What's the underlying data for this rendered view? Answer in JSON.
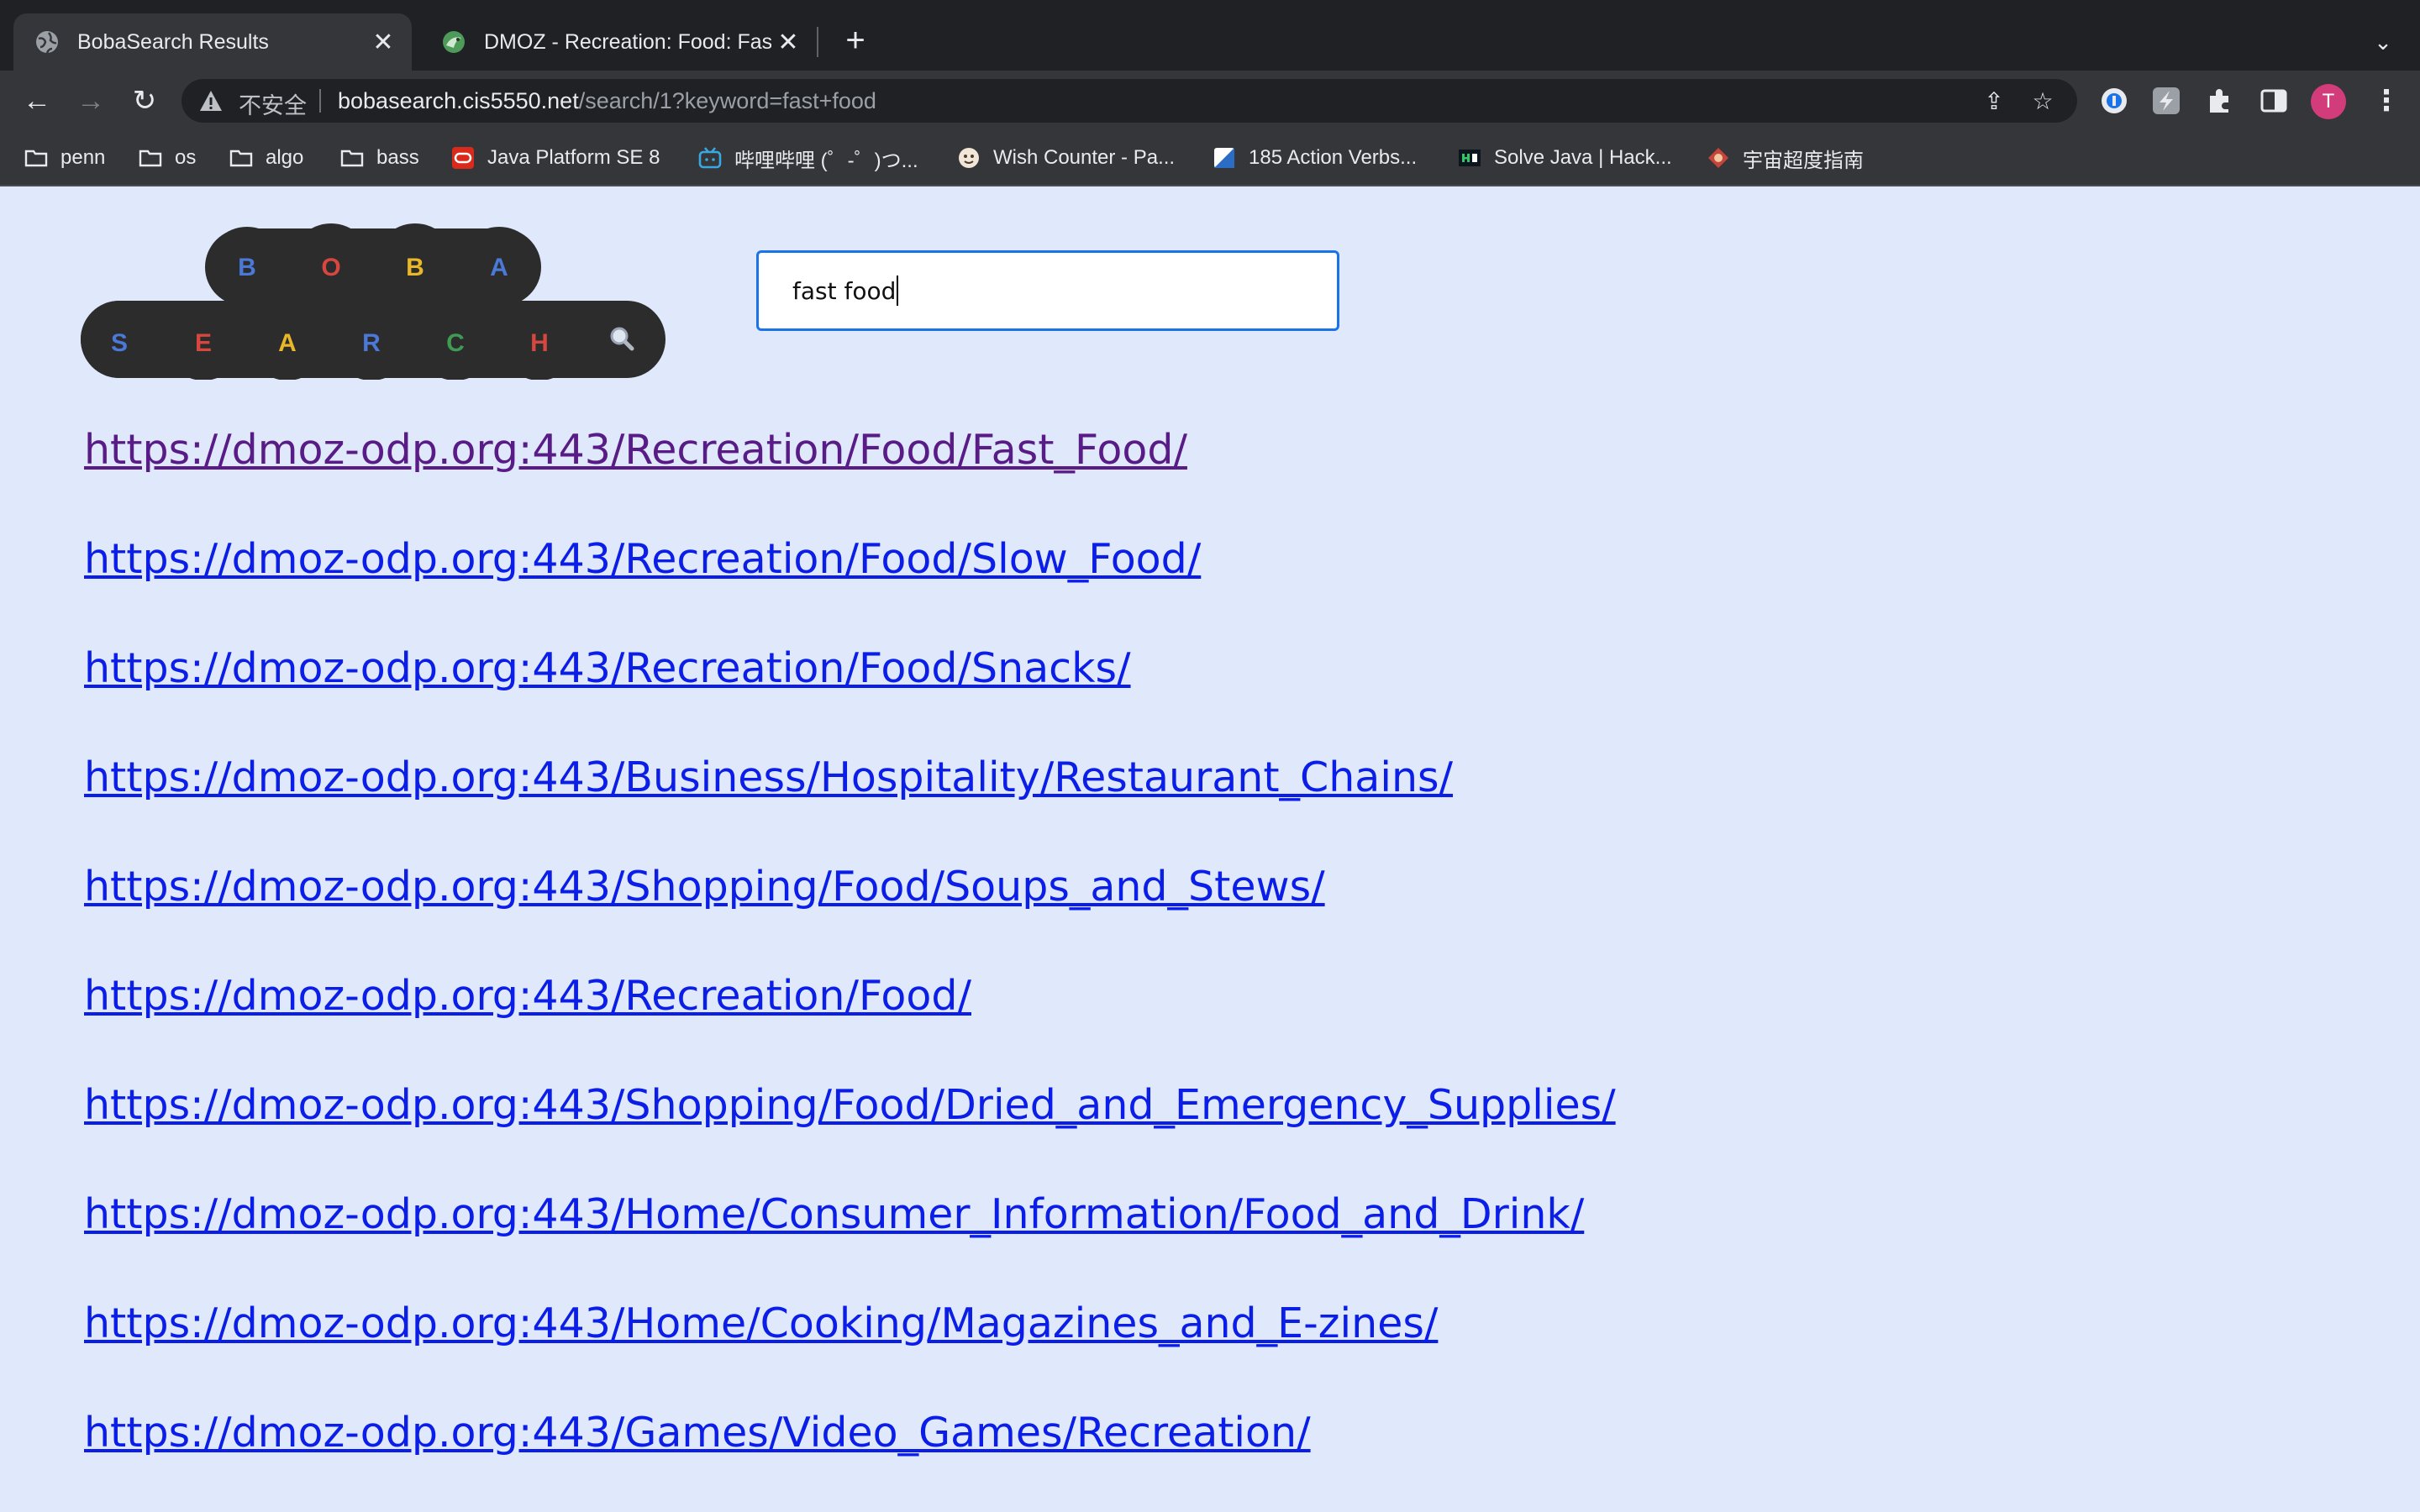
{
  "browser": {
    "tabs": [
      {
        "title": "BobaSearch Results",
        "favicon": "globe-icon",
        "active": true
      },
      {
        "title": "DMOZ - Recreation: Food: Fast Food",
        "favicon": "dmoz-icon",
        "active": false
      }
    ],
    "address": {
      "security_label": "不安全",
      "host": "bobasearch.cis5550.net",
      "path": "/search/1?keyword=fast+food"
    },
    "bookmarks": [
      {
        "label": "penn",
        "icon": "folder-icon"
      },
      {
        "label": "os",
        "icon": "folder-icon"
      },
      {
        "label": "algo",
        "icon": "folder-icon"
      },
      {
        "label": "bass",
        "icon": "folder-icon"
      },
      {
        "label": "Java Platform SE 8",
        "icon": "oracle-icon"
      },
      {
        "label": "哔哩哔哩 (゜-゜)つ...",
        "icon": "bilibili-icon"
      },
      {
        "label": "Wish Counter - Pa...",
        "icon": "wish-icon"
      },
      {
        "label": "185 Action Verbs...",
        "icon": "doc-icon"
      },
      {
        "label": "Solve Java | Hack...",
        "icon": "hackerrank-icon"
      },
      {
        "label": "宇宙超度指南",
        "icon": "guide-icon"
      }
    ],
    "profile_initial": "T"
  },
  "logo": {
    "top_letters": [
      "B",
      "O",
      "B",
      "A"
    ],
    "bottom_letters": [
      "S",
      "E",
      "A",
      "R",
      "C",
      "H"
    ],
    "colors": {
      "blue": "#4a79d8",
      "red": "#d6473f",
      "yellow": "#e9b728",
      "green": "#3f9a54",
      "bubble": "#2c2c2c"
    }
  },
  "search": {
    "query": "fast food"
  },
  "results": [
    {
      "url": "https://dmoz-odp.org:443/Recreation/Food/Fast_Food/",
      "visited": true
    },
    {
      "url": "https://dmoz-odp.org:443/Recreation/Food/Slow_Food/",
      "visited": false
    },
    {
      "url": "https://dmoz-odp.org:443/Recreation/Food/Snacks/",
      "visited": false
    },
    {
      "url": "https://dmoz-odp.org:443/Business/Hospitality/Restaurant_Chains/",
      "visited": false
    },
    {
      "url": "https://dmoz-odp.org:443/Shopping/Food/Soups_and_Stews/",
      "visited": false
    },
    {
      "url": "https://dmoz-odp.org:443/Recreation/Food/",
      "visited": false
    },
    {
      "url": "https://dmoz-odp.org:443/Shopping/Food/Dried_and_Emergency_Supplies/",
      "visited": false
    },
    {
      "url": "https://dmoz-odp.org:443/Home/Consumer_Information/Food_and_Drink/",
      "visited": false
    },
    {
      "url": "https://dmoz-odp.org:443/Home/Cooking/Magazines_and_E-zines/",
      "visited": false
    },
    {
      "url": "https://dmoz-odp.org:443/Games/Video_Games/Recreation/",
      "visited": false
    }
  ]
}
